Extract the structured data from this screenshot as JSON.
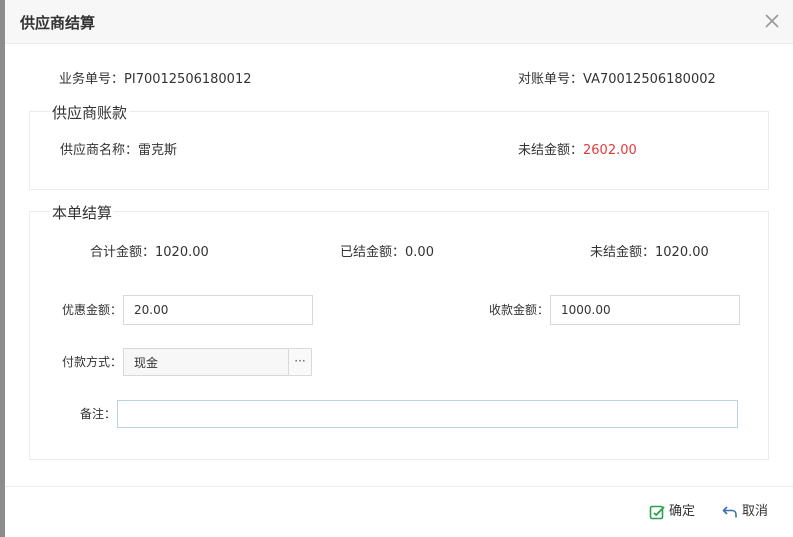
{
  "dialog": {
    "title": "供应商结算"
  },
  "header_info": {
    "business_no_label": "业务单号：",
    "business_no": "PI70012506180012",
    "statement_no_label": "对账单号：",
    "statement_no": "VA70012506180002"
  },
  "supplier_account": {
    "legend": "供应商账款",
    "name_label": "供应商名称：",
    "name": "雷克斯",
    "unsettled_label": "未结金额：",
    "unsettled": "2602.00"
  },
  "settlement": {
    "legend": "本单结算",
    "total_label": "合计金额：",
    "total": "1020.00",
    "settled_label": "已结金额：",
    "settled": "0.00",
    "unsettled_label": "未结金额：",
    "unsettled": "1020.00",
    "discount_label": "优惠金额：",
    "discount_value": "20.00",
    "received_label": "收款金额：",
    "received_value": "1000.00",
    "payment_label": "付款方式：",
    "payment_value": "现金",
    "payment_more": "···",
    "remark_label": "备注：",
    "remark_value": ""
  },
  "footer": {
    "confirm_label": "确定",
    "cancel_label": "取消"
  },
  "colors": {
    "accent_red": "#e4393c",
    "confirm_icon": "#2e9e4f",
    "cancel_icon": "#3a6fb0"
  },
  "icons": {
    "close": "close-icon",
    "confirm": "edit-check-icon",
    "cancel": "undo-arrow-icon"
  }
}
